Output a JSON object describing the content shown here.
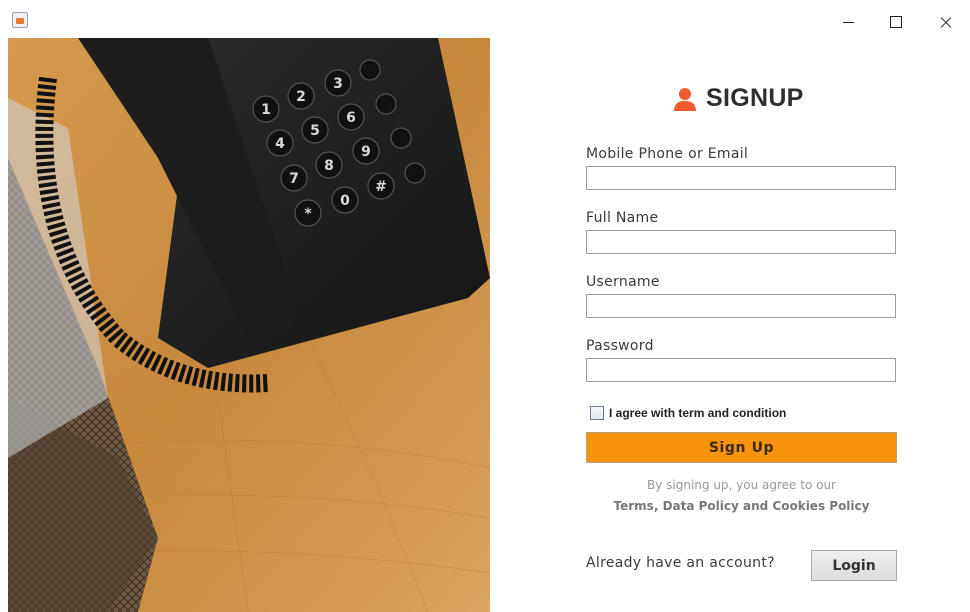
{
  "window": {
    "app_icon": "java-cup-icon",
    "minimize": "minimize-icon",
    "maximize": "maximize-icon",
    "close": "close-icon"
  },
  "image": {
    "subject": "desk-phone-photo",
    "keypad": [
      "1",
      "2",
      "3",
      "4",
      "5",
      "6",
      "7",
      "8",
      "9",
      "*",
      "0",
      "#"
    ]
  },
  "form": {
    "heading": "SIGNUP",
    "heading_icon": "user-icon",
    "accent_color": "#f7930c",
    "fields": [
      {
        "label": "Mobile Phone or Email",
        "value": ""
      },
      {
        "label": "Full Name",
        "value": ""
      },
      {
        "label": "Username",
        "value": ""
      },
      {
        "label": "Password",
        "value": ""
      }
    ],
    "agree_label": "I agree with term and condition",
    "agree_checked": false,
    "signup_label": "Sign Up",
    "fine_print_1": "By signing up, you agree to our",
    "fine_print_2": "Terms, Data Policy and Cookies Policy",
    "already_text": "Already have an account?",
    "login_label": "Login"
  }
}
